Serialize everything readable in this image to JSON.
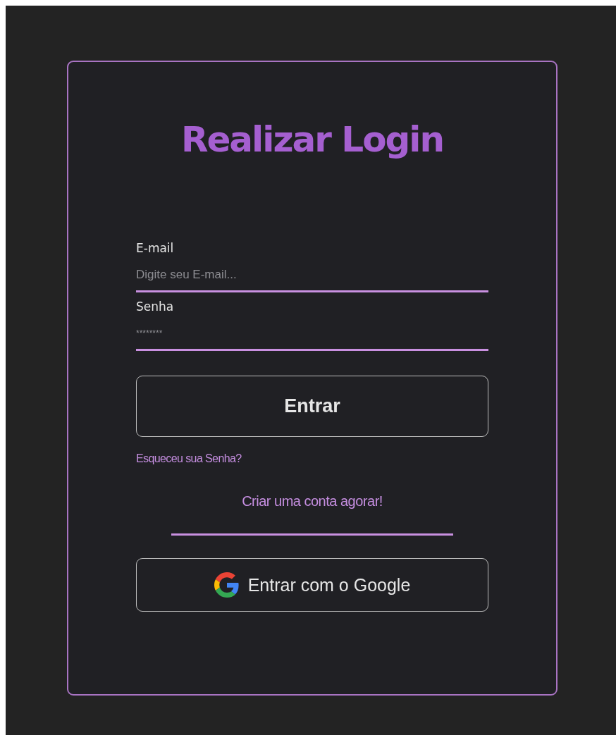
{
  "title": "Realizar Login",
  "fields": [
    {
      "label": "E-mail",
      "placeholder": "Digite seu E-mail...",
      "kind": "text"
    },
    {
      "label": "Senha",
      "placeholder": "********",
      "kind": "password"
    }
  ],
  "submit": "Entrar",
  "forgot_link": "Esqueceu sua Senha?",
  "signup_link": "Criar uma conta agorar!",
  "google_button": "Entrar com o Google"
}
